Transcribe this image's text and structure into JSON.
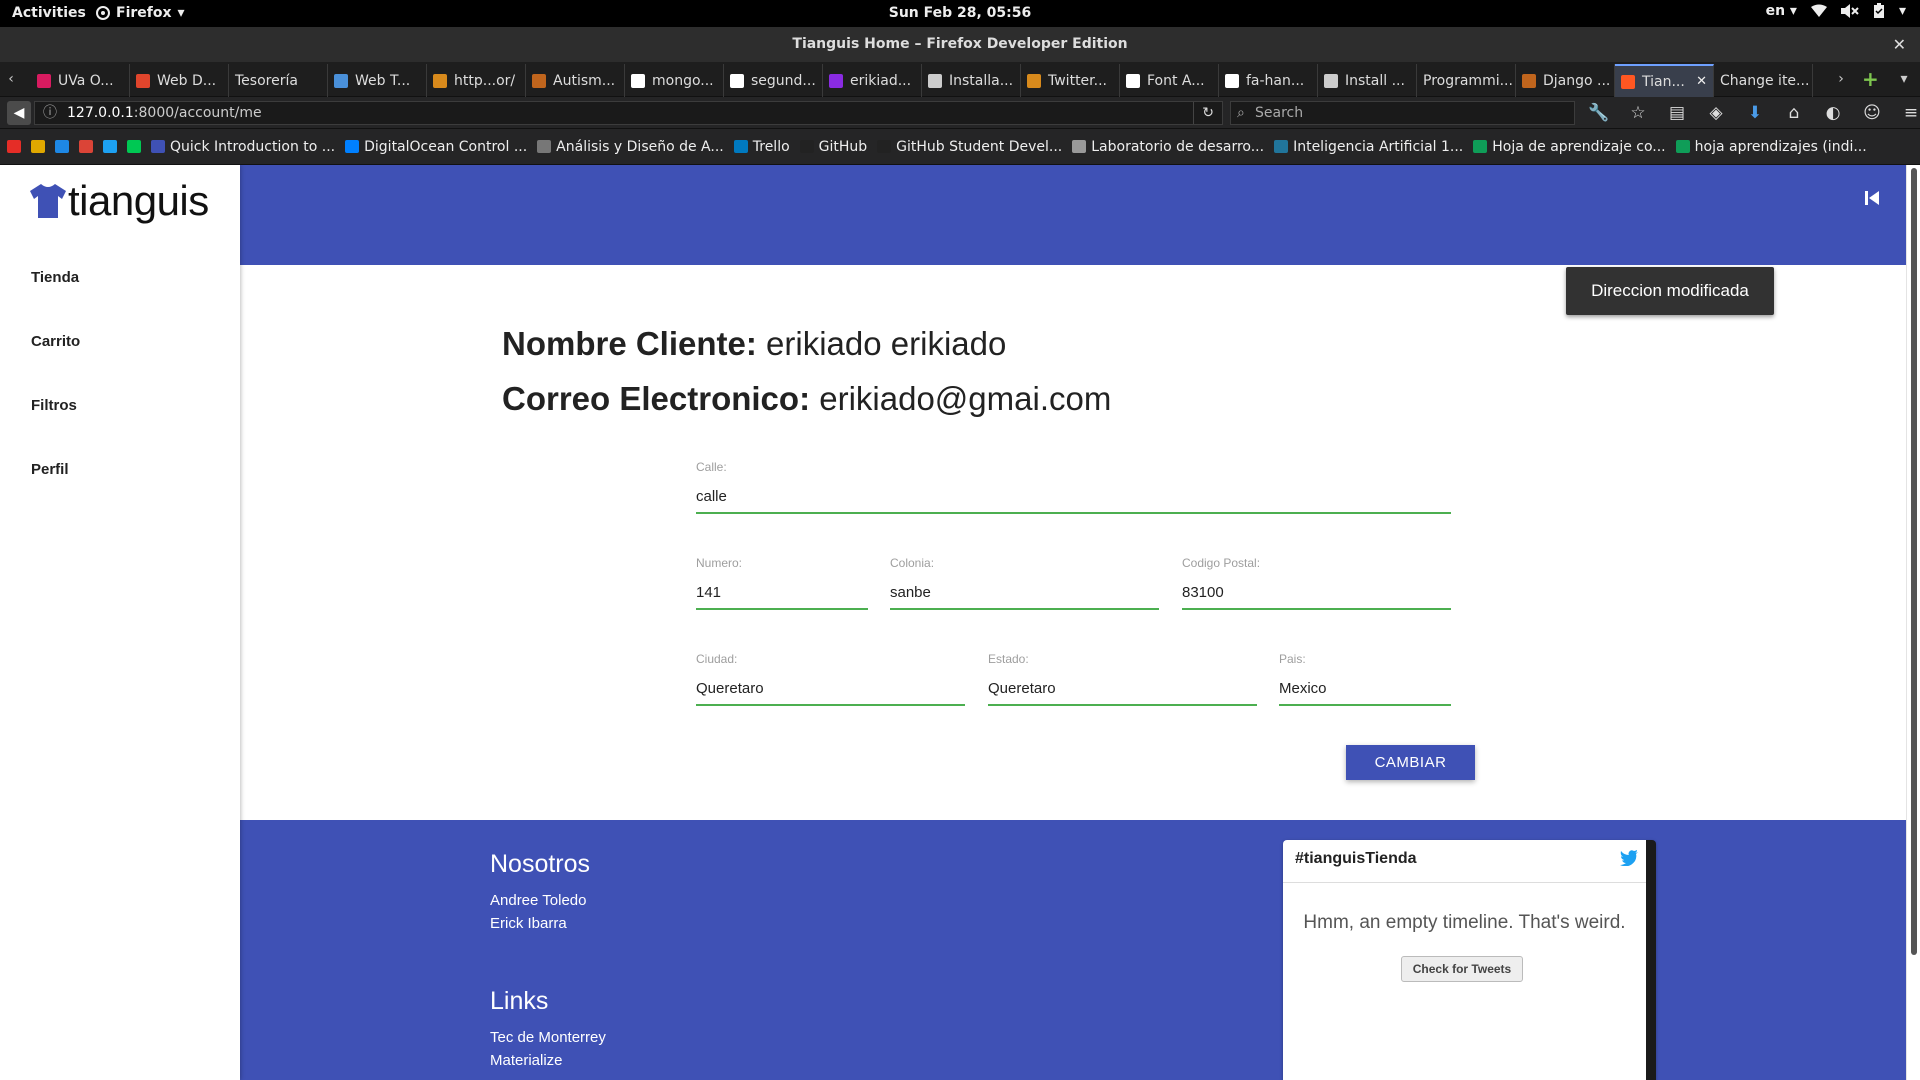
{
  "system": {
    "activities": "Activities",
    "app_menu": "Firefox",
    "clock": "Sun Feb 28, 05:56",
    "lang": "en"
  },
  "window": {
    "title": "Tianguis Home – Firefox Developer Edition"
  },
  "tabs": [
    {
      "label": "UVa O...",
      "color": "#d81b60",
      "active": false
    },
    {
      "label": "Web D...",
      "color": "#e0452c",
      "active": false
    },
    {
      "label": "Tesorería",
      "color": "",
      "active": false
    },
    {
      "label": "Web T...",
      "color": "#4a90d9",
      "active": false
    },
    {
      "label": "http...or/",
      "color": "#d88a1c",
      "active": false
    },
    {
      "label": "Autism...",
      "color": "#c0651d",
      "active": false
    },
    {
      "label": "mongo...",
      "color": "#ffffff",
      "active": false
    },
    {
      "label": "segund...",
      "color": "#ffffff",
      "active": false
    },
    {
      "label": "erikiad...",
      "color": "#8a2be2",
      "active": false
    },
    {
      "label": "Installa...",
      "color": "#cccccc",
      "active": false
    },
    {
      "label": "Twitter...",
      "color": "#d88a1c",
      "active": false
    },
    {
      "label": "Font A...",
      "color": "#ffffff",
      "active": false
    },
    {
      "label": "fa-han...",
      "color": "#ffffff",
      "active": false
    },
    {
      "label": "Install ...",
      "color": "#cccccc",
      "active": false
    },
    {
      "label": "Programmi...",
      "color": "",
      "active": false
    },
    {
      "label": "Django ...",
      "color": "#c0651d",
      "active": false
    },
    {
      "label": "Tian...",
      "color": "#ff5722",
      "active": true
    },
    {
      "label": "Change ite...",
      "color": "",
      "active": false
    }
  ],
  "nav": {
    "url_host": "127.0.0.1",
    "url_path": ":8000/account/me",
    "search_placeholder": "Search"
  },
  "bookmarks": [
    {
      "label": "",
      "color": "#e52d27"
    },
    {
      "label": "",
      "color": "#e0a800"
    },
    {
      "label": "",
      "color": "#1e88e5"
    },
    {
      "label": "",
      "color": "#db4437"
    },
    {
      "label": "",
      "color": "#1da1f2"
    },
    {
      "label": "",
      "color": "#00c853"
    },
    {
      "label": "Quick Introduction to ...",
      "color": "#3f51b5"
    },
    {
      "label": "DigitalOcean Control ...",
      "color": "#0080ff"
    },
    {
      "label": "Análisis y Diseño de A...",
      "color": "#777777"
    },
    {
      "label": "Trello",
      "color": "#0079bf"
    },
    {
      "label": "GitHub",
      "color": "#222222"
    },
    {
      "label": "GitHub Student Devel...",
      "color": "#222222"
    },
    {
      "label": "Laboratorio de desarro...",
      "color": "#999999"
    },
    {
      "label": "Inteligencia Artificial 1...",
      "color": "#21759b"
    },
    {
      "label": "Hoja de aprendizaje co...",
      "color": "#0f9d58"
    },
    {
      "label": "hoja aprendizajes (indi...",
      "color": "#0f9d58"
    }
  ],
  "app": {
    "brand": "tianguis",
    "sidebar": [
      "Tienda",
      "Carrito",
      "Filtros",
      "Perfil"
    ],
    "toast": "Direccion modificada",
    "cliente_label": "Nombre Cliente:",
    "cliente_value": "erikiado erikiado",
    "correo_label": "Correo Electronico:",
    "correo_value": "erikiado@gmai.com",
    "form": {
      "calle": {
        "label": "Calle:",
        "value": "calle"
      },
      "numero": {
        "label": "Numero:",
        "value": "141"
      },
      "colonia": {
        "label": "Colonia:",
        "value": "sanbe"
      },
      "cp": {
        "label": "Codigo Postal:",
        "value": "83100"
      },
      "ciudad": {
        "label": "Ciudad:",
        "value": "Queretaro"
      },
      "estado": {
        "label": "Estado:",
        "value": "Queretaro"
      },
      "pais": {
        "label": "Pais:",
        "value": "Mexico"
      }
    },
    "submit": "CAMBIAR",
    "footer": {
      "nosotros_title": "Nosotros",
      "nosotros": [
        "Andree Toledo",
        "Erick Ibarra"
      ],
      "links_title": "Links",
      "links": [
        "Tec de Monterrey",
        "Materialize"
      ]
    },
    "twitter": {
      "title": "#tianguisTienda",
      "empty": "Hmm, an empty timeline. That's weird.",
      "button": "Check for Tweets"
    }
  },
  "colors": {
    "primary": "#3f51b5",
    "input_border": "#4caf50",
    "toast_bg": "#323232",
    "active_tab_accent": "#6ea0ff"
  }
}
